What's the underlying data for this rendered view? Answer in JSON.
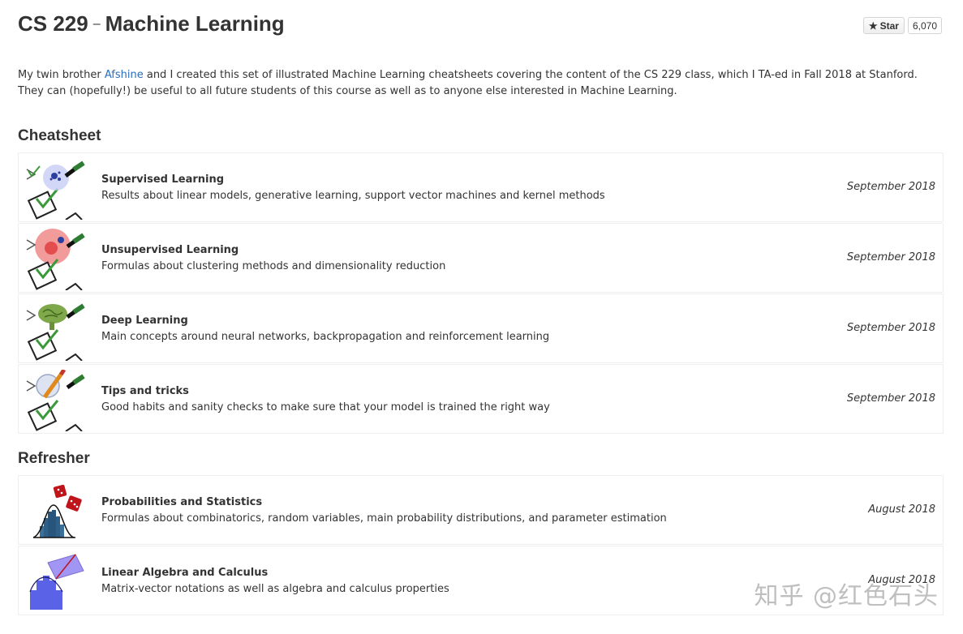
{
  "header": {
    "course": "CS 229",
    "separator": "–",
    "subject": "Machine Learning"
  },
  "github": {
    "star_icon": "star-icon",
    "star_label": "Star",
    "star_count": "6,070"
  },
  "intro": {
    "before_link": "My twin brother ",
    "link_text": "Afshine",
    "after_link": " and I created this set of illustrated Machine Learning cheatsheets covering the content of the CS 229 class, which I TA-ed in Fall 2018 at Stanford. They can (hopefully!) be useful to all future students of this course as well as to anyone else interested in Machine Learning."
  },
  "cheatsheet": {
    "title": "Cheatsheet",
    "items": [
      {
        "name": "Supervised Learning",
        "desc": "Results about linear models, generative learning, support vector machines and kernel methods",
        "date": "September 2018",
        "icon": "supervised-learning-icon"
      },
      {
        "name": "Unsupervised Learning",
        "desc": "Formulas about clustering methods and dimensionality reduction",
        "date": "September 2018",
        "icon": "unsupervised-learning-icon"
      },
      {
        "name": "Deep Learning",
        "desc": "Main concepts around neural networks, backpropagation and reinforcement learning",
        "date": "September 2018",
        "icon": "deep-learning-icon"
      },
      {
        "name": "Tips and tricks",
        "desc": "Good habits and sanity checks to make sure that your model is trained the right way",
        "date": "September 2018",
        "icon": "tips-and-tricks-icon"
      }
    ]
  },
  "refresher": {
    "title": "Refresher",
    "items": [
      {
        "name": "Probabilities and Statistics",
        "desc": "Formulas about combinatorics, random variables, main probability distributions, and parameter estimation",
        "date": "August 2018",
        "icon": "probabilities-dice-icon"
      },
      {
        "name": "Linear Algebra and Calculus",
        "desc": "Matrix-vector notations as well as algebra and calculus properties",
        "date": "August 2018",
        "icon": "linear-algebra-icon"
      }
    ]
  },
  "watermark": "知乎 @红色石头",
  "colors": {
    "link": "#2a6ebb",
    "text": "#333333",
    "card_border": "#eeeeee"
  }
}
